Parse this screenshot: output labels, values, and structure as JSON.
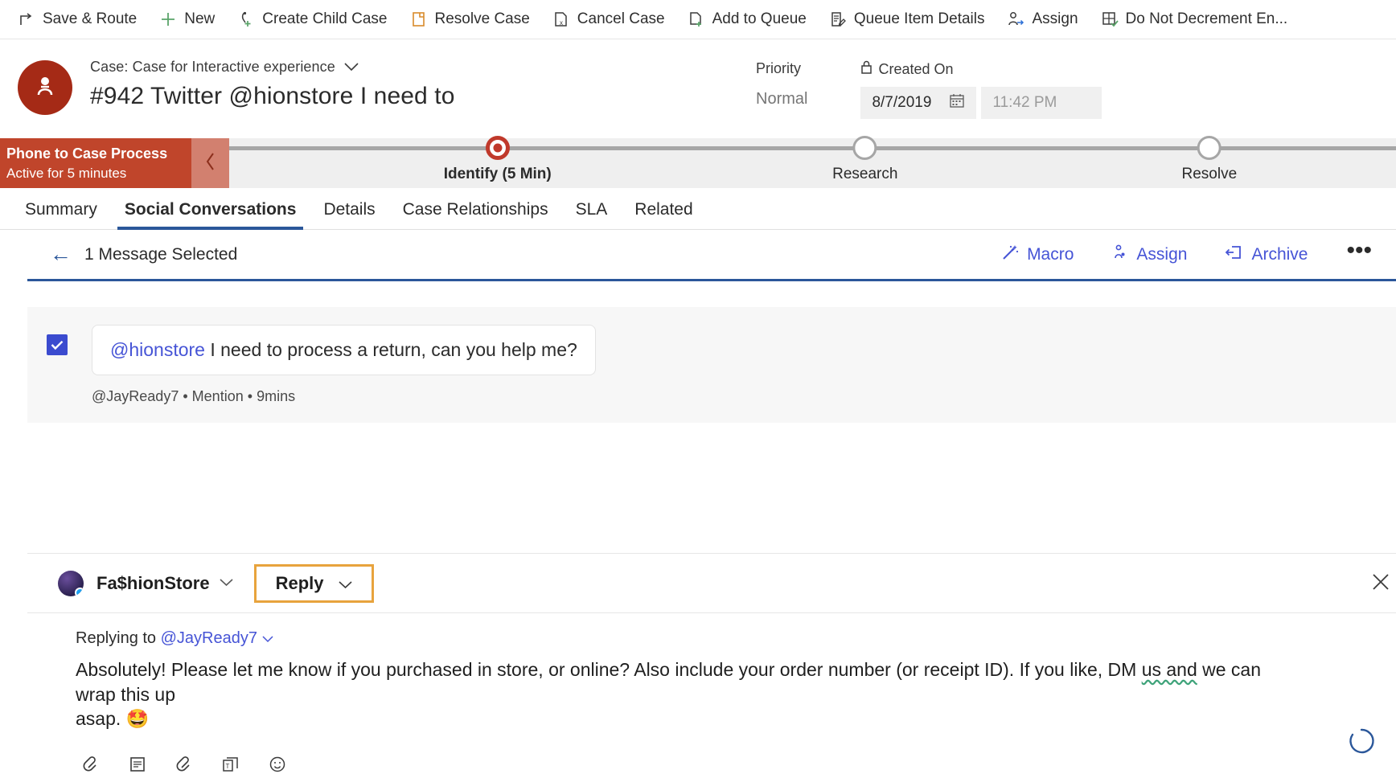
{
  "command_bar": {
    "items": [
      {
        "label": "Save & Route",
        "icon": "save-route-icon"
      },
      {
        "label": "New",
        "icon": "plus-icon"
      },
      {
        "label": "Create Child Case",
        "icon": "create-child-case-icon"
      },
      {
        "label": "Resolve Case",
        "icon": "resolve-case-icon"
      },
      {
        "label": "Cancel Case",
        "icon": "cancel-case-icon"
      },
      {
        "label": "Add to Queue",
        "icon": "add-to-queue-icon"
      },
      {
        "label": "Queue Item Details",
        "icon": "queue-item-details-icon"
      },
      {
        "label": "Assign",
        "icon": "assign-person-icon"
      },
      {
        "label": "Do Not Decrement En...",
        "icon": "do-not-decrement-icon"
      }
    ]
  },
  "record_header": {
    "entity_label": "Case: Case for Interactive experience",
    "title": "#942 Twitter @hionstore I need to",
    "avatar_icon": "contact-avatar-icon",
    "fields": {
      "priority_label": "Priority",
      "priority_value": "Normal",
      "created_on_label": "Created On",
      "created_on_lock_icon": "lock-icon",
      "created_on_date": "8/7/2019",
      "created_on_time": "11:42 PM",
      "calendar_icon": "calendar-icon"
    }
  },
  "process_flow": {
    "name": "Phone to Case Process",
    "status": "Active for 5 minutes",
    "collapse_icon": "chevron-left-icon",
    "stages": [
      {
        "label": "Identify  (5 Min)",
        "state": "active"
      },
      {
        "label": "Research",
        "state": "pending"
      },
      {
        "label": "Resolve",
        "state": "pending"
      }
    ]
  },
  "tabs": [
    {
      "label": "Summary",
      "selected": false
    },
    {
      "label": "Social Conversations",
      "selected": true
    },
    {
      "label": "Details",
      "selected": false
    },
    {
      "label": "Case Relationships",
      "selected": false
    },
    {
      "label": "SLA",
      "selected": false
    },
    {
      "label": "Related",
      "selected": false
    }
  ],
  "conversation": {
    "back_icon": "back-arrow-icon",
    "selection_text": "1 Message Selected",
    "actions": [
      {
        "label": "Macro",
        "icon": "magic-wand-icon"
      },
      {
        "label": "Assign",
        "icon": "assign-person-icon"
      },
      {
        "label": "Archive",
        "icon": "archive-icon"
      }
    ],
    "overflow": "•••",
    "message": {
      "checkbox_checked": true,
      "mention": "@hionstore",
      "text": " I need to process a return, can you help me?",
      "author": "@JayReady7",
      "type": "Mention",
      "age": "9mins",
      "meta_separator": "•"
    }
  },
  "composer": {
    "account_name": "Fa$hionStore",
    "account_caret_icon": "chevron-down-icon",
    "reply_button": "Reply",
    "reply_caret_icon": "chevron-down-icon",
    "close_icon": "close-icon",
    "replying_to_prefix": "Replying to ",
    "replying_to_handle": "@JayReady7",
    "replying_to_caret_icon": "chevron-down-icon",
    "body_line1": "Absolutely!  Please let me know if you purchased in store, or online?  Also include your order number (or receipt ID).  If you like, DM ",
    "body_underlined": "us and",
    "body_line1_end": " we can wrap this up",
    "body_line2": "asap. ",
    "body_emoji": "🤩",
    "tools": [
      {
        "icon": "attach-link-icon"
      },
      {
        "icon": "note-icon"
      },
      {
        "icon": "link-icon"
      },
      {
        "icon": "template-icon"
      },
      {
        "icon": "emoji-icon"
      }
    ],
    "spinner_icon": "loading-spinner-icon"
  },
  "colors": {
    "brand_red": "#c0452b",
    "accent_blue": "#2b579a",
    "link_blue": "#4654d6",
    "reply_border": "#e8a33d",
    "avatar_bg": "#a52a16"
  }
}
